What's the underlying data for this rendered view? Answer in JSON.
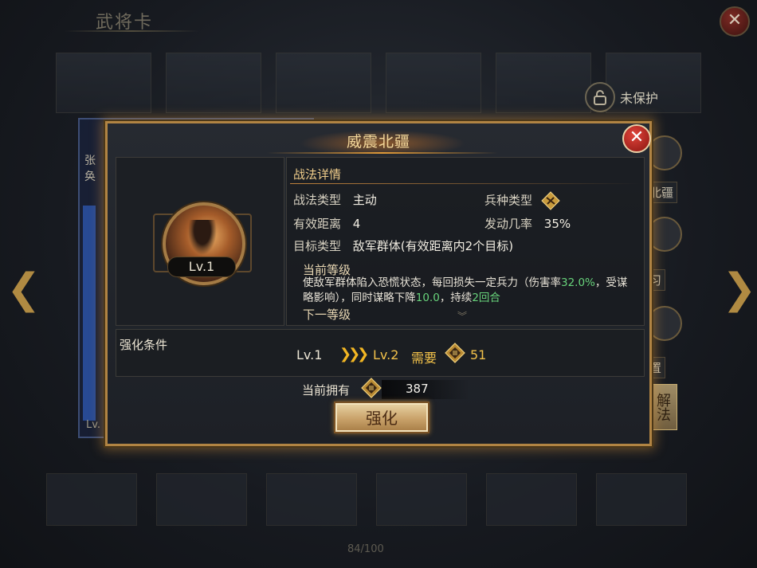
{
  "background": {
    "title": "武将卡",
    "close_glyph": "✕",
    "lock_label": "未保护",
    "hero_name": "张奂",
    "left_arrow": "❮",
    "right_arrow": "❯",
    "side_labels": [
      "北疆",
      "习",
      "置"
    ],
    "side_button": "解法",
    "lv_stub": "Lv.",
    "page_indicator": "84/100"
  },
  "dialog": {
    "title": "威震北疆",
    "close_glyph": "✕",
    "skill_level_badge": "Lv.1",
    "details": {
      "section_title": "战法详情",
      "skill_type_label": "战法类型",
      "skill_type_value": "主动",
      "troop_type_label": "兵种类型",
      "troop_type_icon": "troop-type-icon",
      "range_label": "有效距离",
      "range_value": "4",
      "trigger_rate_label": "发动几率",
      "trigger_rate_value": "35%",
      "target_label": "目标类型",
      "target_value": "敌军群体(有效距离内2个目标)",
      "current_level_label": "当前等级",
      "desc_part1": "使敌军群体陷入恐慌状态，每回损失一定兵力（伤害率",
      "desc_damage_rate": "32.0%",
      "desc_part2": "，受谋略影响），同时谋略下降",
      "desc_stat_drop": "10.0",
      "desc_part3": "，持续",
      "desc_duration": "2回合",
      "next_level_label": "下一等级",
      "scroll_hint": "︾"
    },
    "condition": {
      "label": "强化条件",
      "from_level": "Lv.1",
      "arrows": "❯❯❯",
      "to_level": "Lv.2",
      "need_label": "需要",
      "need_amount": "51",
      "resource_icon": "skill-book-icon"
    },
    "owned": {
      "label": "当前拥有",
      "amount": "387"
    },
    "strengthen_button": "强化"
  },
  "colors": {
    "dialog_border": "#b18443",
    "title_text": "#f3d79a",
    "highlight_green": "#68d37b",
    "gold_text": "#f2c14a"
  }
}
